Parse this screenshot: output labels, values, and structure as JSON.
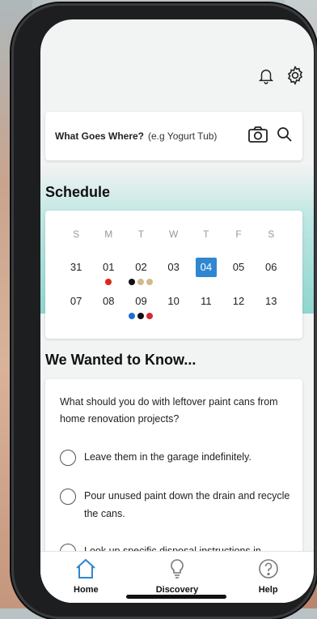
{
  "search": {
    "label": "What Goes Where?",
    "placeholder": "(e.g Yogurt Tub)"
  },
  "top_icons": [
    "bell-icon",
    "gear-icon"
  ],
  "schedule": {
    "title": "Schedule",
    "weekdays": [
      "S",
      "M",
      "T",
      "W",
      "T",
      "F",
      "S"
    ],
    "weeks": [
      [
        {
          "day": "31",
          "dots": []
        },
        {
          "day": "01",
          "dots": [
            "#e0241b"
          ]
        },
        {
          "day": "02",
          "dots": [
            "#111111",
            "#d2b98c",
            "#d2b98c"
          ]
        },
        {
          "day": "03",
          "dots": []
        },
        {
          "day": "04",
          "dots": [],
          "selected": true
        },
        {
          "day": "05",
          "dots": []
        },
        {
          "day": "06",
          "dots": []
        }
      ],
      [
        {
          "day": "07",
          "dots": []
        },
        {
          "day": "08",
          "dots": []
        },
        {
          "day": "09",
          "dots": [
            "#1f6fd1",
            "#111111",
            "#d12a36"
          ]
        },
        {
          "day": "10",
          "dots": []
        },
        {
          "day": "11",
          "dots": []
        },
        {
          "day": "12",
          "dots": []
        },
        {
          "day": "13",
          "dots": []
        }
      ]
    ],
    "selected_color": "#2f86d1"
  },
  "quiz": {
    "title": "We Wanted to Know...",
    "question": "What should you do with leftover paint cans from home renovation projects?",
    "options": [
      "Leave them in the garage indefinitely.",
      "Pour unused paint down the drain and recycle the cans.",
      "Look up specific disposal instructions in"
    ]
  },
  "nav": {
    "items": [
      {
        "label": "Home",
        "icon": "home-icon",
        "active": true
      },
      {
        "label": "Discovery",
        "icon": "lightbulb-icon"
      },
      {
        "label": "Help",
        "icon": "help-icon"
      }
    ],
    "active_color": "#2f86d1"
  }
}
